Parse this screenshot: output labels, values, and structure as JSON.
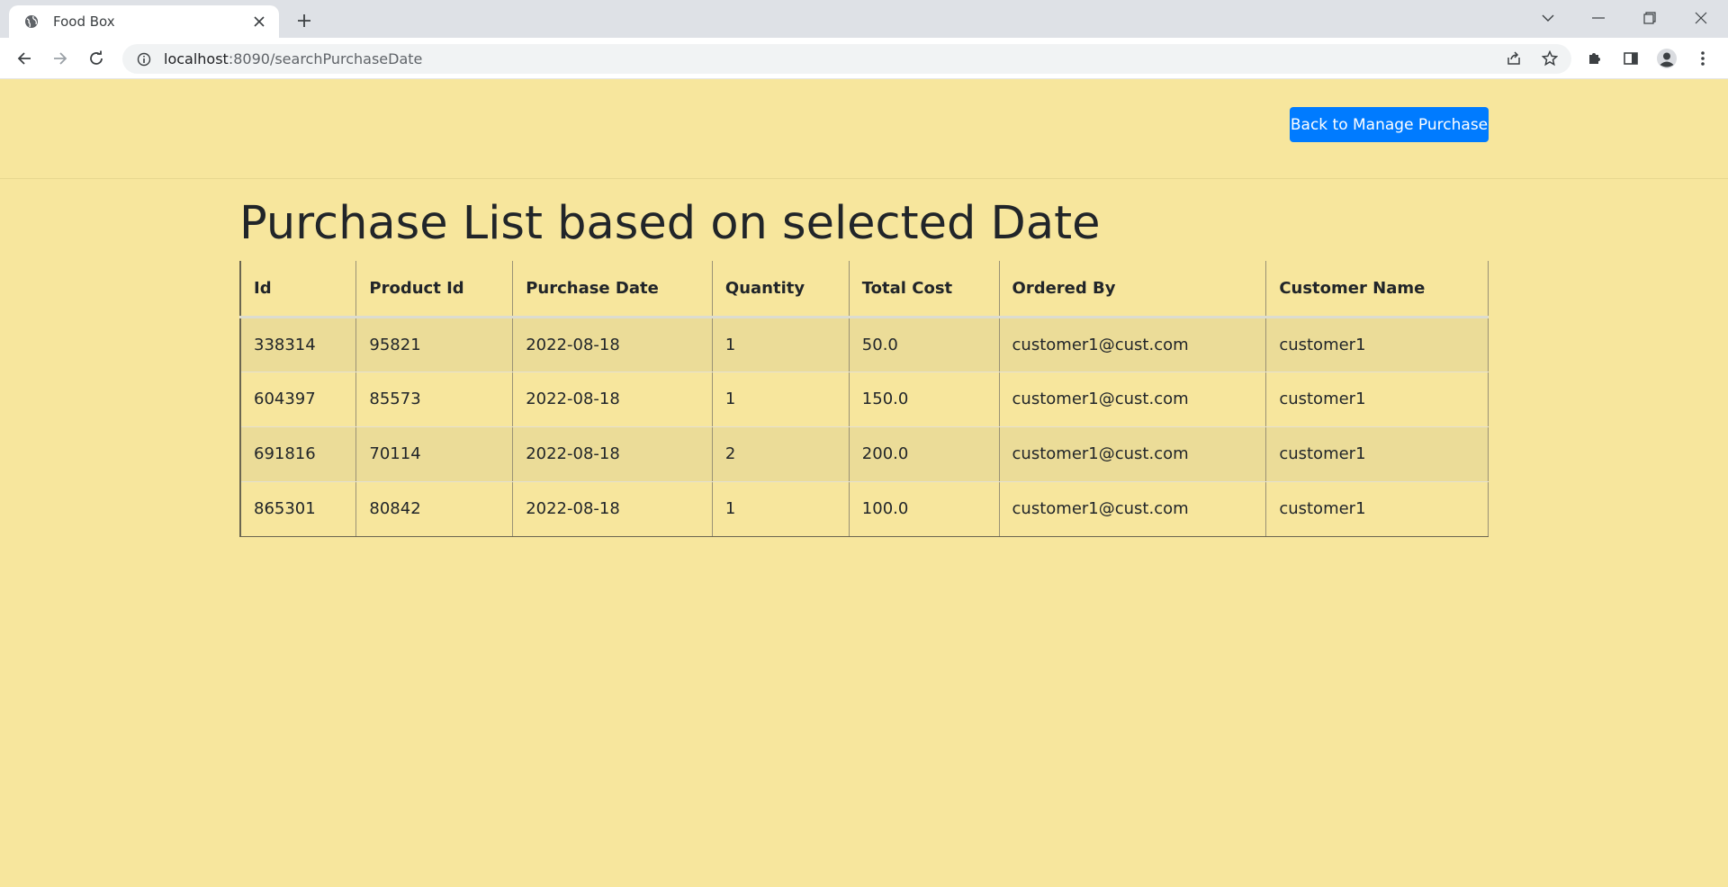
{
  "browser": {
    "tab_title": "Food Box",
    "url_host": "localhost",
    "url_path": ":8090/searchPurchaseDate"
  },
  "icons": {
    "favicon": "globe-icon",
    "new_tab": "plus-icon",
    "back": "arrow-left-icon",
    "forward": "arrow-right-icon",
    "reload": "reload-icon",
    "site_info": "info-icon",
    "share": "share-icon",
    "bookmark": "star-icon",
    "extensions": "puzzle-icon",
    "side_panel": "side-panel-icon",
    "profile": "profile-icon",
    "menu": "kebab-menu-icon"
  },
  "header": {
    "back_button_label": "Back to Manage Purchase"
  },
  "main": {
    "title": "Purchase List based on selected Date",
    "table": {
      "columns": [
        "Id",
        "Product Id",
        "Purchase Date",
        "Quantity",
        "Total Cost",
        "Ordered By",
        "Customer Name"
      ],
      "rows": [
        [
          "338314",
          "95821",
          "2022-08-18",
          "1",
          "50.0",
          "customer1@cust.com",
          "customer1"
        ],
        [
          "604397",
          "85573",
          "2022-08-18",
          "1",
          "150.0",
          "customer1@cust.com",
          "customer1"
        ],
        [
          "691816",
          "70114",
          "2022-08-18",
          "2",
          "200.0",
          "customer1@cust.com",
          "customer1"
        ],
        [
          "865301",
          "80842",
          "2022-08-18",
          "1",
          "100.0",
          "customer1@cust.com",
          "customer1"
        ]
      ]
    }
  },
  "colors": {
    "page_background": "#f7e69d",
    "button_primary": "#007bff",
    "striped_row": "#ebdc98"
  }
}
